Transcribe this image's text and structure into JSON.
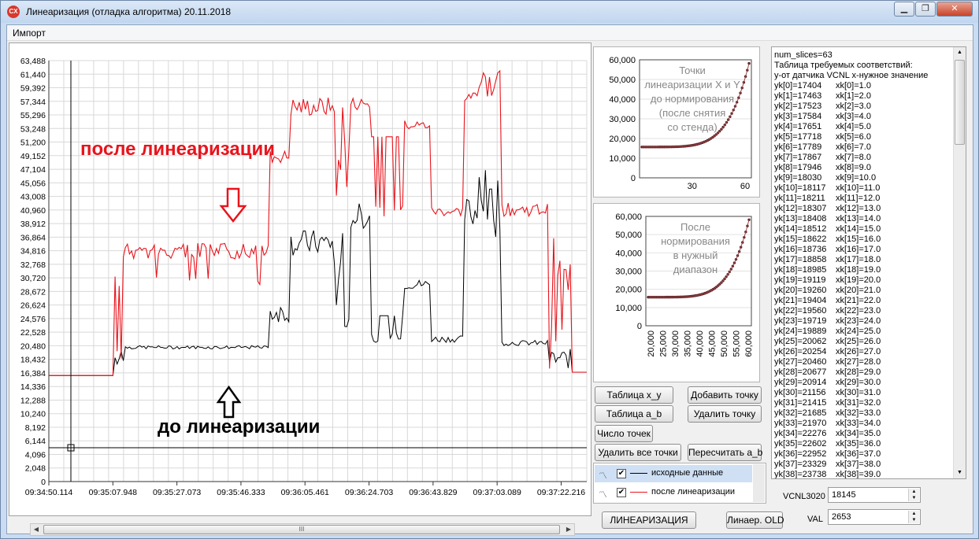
{
  "window": {
    "title": "Линеаризация (отладка алгоритма) 20.11.2018",
    "icon_text": "CX"
  },
  "menu": {
    "import": "Импорт"
  },
  "main_chart": {
    "y_ticks": [
      "63,488",
      "61,440",
      "59,392",
      "57,344",
      "55,296",
      "53,248",
      "51,200",
      "49,152",
      "47,104",
      "45,056",
      "43,008",
      "40,960",
      "38,912",
      "36,864",
      "34,816",
      "32,768",
      "30,720",
      "28,672",
      "26,624",
      "24,576",
      "22,528",
      "20,480",
      "18,432",
      "16,384",
      "14,336",
      "12,288",
      "10,240",
      "8,192",
      "6,144",
      "4,096",
      "2,048",
      "0"
    ],
    "x_ticks": [
      "09:34:50.114",
      "09:35:07.948",
      "09:35:27.073",
      "09:35:46.333",
      "09:36:05.461",
      "09:36:24.703",
      "09:36:43.829",
      "09:37:03.089",
      "09:37:22.216"
    ],
    "annotation_after": "после линеаризации",
    "annotation_before": "до линеаризации",
    "after_color": "#e8141c",
    "before_color": "#000000"
  },
  "mini1": {
    "title_lines": [
      "Точки",
      "линеаризации X и Y",
      "до нормирования",
      "(после снятия",
      "со стенда)"
    ],
    "y_ticks": [
      "60,000",
      "50,000",
      "40,000",
      "30,000",
      "20,000",
      "10,000",
      "0"
    ],
    "x_ticks": [
      "30",
      "60"
    ]
  },
  "mini2": {
    "title_lines": [
      "После",
      "нормирования",
      "в нужный",
      "диапазон"
    ],
    "y_ticks": [
      "60,000",
      "50,000",
      "40,000",
      "30,000",
      "20,000",
      "10,000",
      "0"
    ],
    "x_ticks": [
      "20,000",
      "25,000",
      "30,000",
      "35,000",
      "40,000",
      "45,000",
      "50,000",
      "55,000",
      "60,000"
    ]
  },
  "buttons": {
    "table_xy": "Таблица x_y",
    "add_point": "Добавить точку",
    "table_ab": "Таблица a_b",
    "delete_point": "Удалить точку",
    "point_count": "Число точек",
    "delete_all": "Удалить все точки",
    "recalc_ab": "Пересчитать a_b",
    "linearize": "ЛИНЕАРИЗАЦИЯ",
    "linear_old": "Линаер. OLD"
  },
  "legend": {
    "items": [
      {
        "label": "исходные данные",
        "checked": "✔",
        "color": "#000000"
      },
      {
        "label": "после линеаризации",
        "checked": "✔",
        "color": "#e8141c"
      }
    ]
  },
  "log": {
    "header": [
      "num_slices=63",
      "Таблица требуемых соответствий:",
      "у-от датчика VCNL х-нужное значение"
    ],
    "rows": [
      [
        "yk[0]=17404",
        "xk[0]=1.0"
      ],
      [
        "yk[1]=17463",
        "xk[1]=2.0"
      ],
      [
        "yk[2]=17523",
        "xk[2]=3.0"
      ],
      [
        "yk[3]=17584",
        "xk[3]=4.0"
      ],
      [
        "yk[4]=17651",
        "xk[4]=5.0"
      ],
      [
        "yk[5]=17718",
        "xk[5]=6.0"
      ],
      [
        "yk[6]=17789",
        "xk[6]=7.0"
      ],
      [
        "yk[7]=17867",
        "xk[7]=8.0"
      ],
      [
        "yk[8]=17946",
        "xk[8]=9.0"
      ],
      [
        "yk[9]=18030",
        "xk[9]=10.0"
      ],
      [
        "yk[10]=18117",
        "xk[10]=11.0"
      ],
      [
        "yk[11]=18211",
        "xk[11]=12.0"
      ],
      [
        "yk[12]=18307",
        "xk[12]=13.0"
      ],
      [
        "yk[13]=18408",
        "xk[13]=14.0"
      ],
      [
        "yk[14]=18512",
        "xk[14]=15.0"
      ],
      [
        "yk[15]=18622",
        "xk[15]=16.0"
      ],
      [
        "yk[16]=18736",
        "xk[16]=17.0"
      ],
      [
        "yk[17]=18858",
        "xk[17]=18.0"
      ],
      [
        "yk[18]=18985",
        "xk[18]=19.0"
      ],
      [
        "yk[19]=19119",
        "xk[19]=20.0"
      ],
      [
        "yk[20]=19260",
        "xk[20]=21.0"
      ],
      [
        "yk[21]=19404",
        "xk[21]=22.0"
      ],
      [
        "yk[22]=19560",
        "xk[22]=23.0"
      ],
      [
        "yk[23]=19719",
        "xk[23]=24.0"
      ],
      [
        "yk[24]=19889",
        "xk[24]=25.0"
      ],
      [
        "yk[25]=20062",
        "xk[25]=26.0"
      ],
      [
        "yk[26]=20254",
        "xk[26]=27.0"
      ],
      [
        "yk[27]=20460",
        "xk[27]=28.0"
      ],
      [
        "yk[28]=20677",
        "xk[28]=29.0"
      ],
      [
        "yk[29]=20914",
        "xk[29]=30.0"
      ],
      [
        "yk[30]=21156",
        "xk[30]=31.0"
      ],
      [
        "yk[31]=21415",
        "xk[31]=32.0"
      ],
      [
        "yk[32]=21685",
        "xk[32]=33.0"
      ],
      [
        "yk[33]=21970",
        "xk[33]=34.0"
      ],
      [
        "yk[34]=22276",
        "xk[34]=35.0"
      ],
      [
        "yk[35]=22602",
        "xk[35]=36.0"
      ],
      [
        "yk[36]=22952",
        "xk[36]=37.0"
      ],
      [
        "yk[37]=23329",
        "xk[37]=38.0"
      ],
      [
        "yk[38]=23738",
        "xk[38]=39.0"
      ]
    ]
  },
  "fields": {
    "vcnl_label": "VCNL3020",
    "vcnl_value": "18145",
    "val_label": "VAL",
    "val_value": "2653"
  },
  "colors": {
    "red": "#e8141c",
    "dark_dot": "#5a1d22",
    "grid": "#d8d8d8"
  }
}
